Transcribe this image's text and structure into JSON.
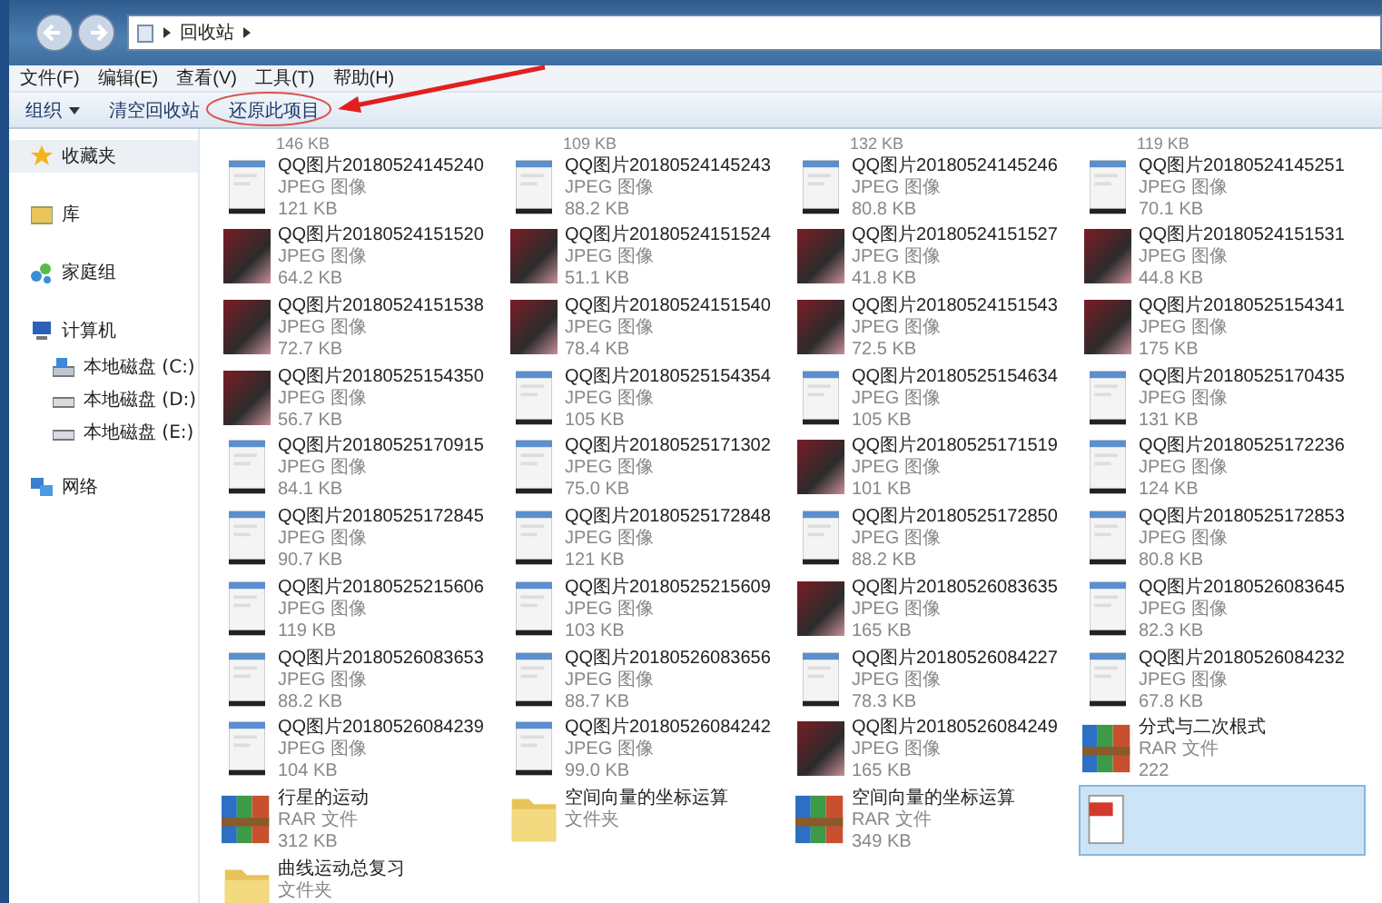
{
  "address": {
    "crumbs": [
      "回收站"
    ]
  },
  "menu": [
    "文件(F)",
    "编辑(E)",
    "查看(V)",
    "工具(T)",
    "帮助(H)"
  ],
  "toolbar": [
    {
      "label": "组织",
      "dropdown": true
    },
    {
      "label": "清空回收站",
      "dropdown": false
    },
    {
      "label": "还原此项目",
      "dropdown": false
    }
  ],
  "sidebar": [
    {
      "label": "收藏夹",
      "selected": true
    },
    {
      "label": "库",
      "selected": false
    },
    {
      "label": "家庭组",
      "selected": false
    },
    {
      "label": "计算机",
      "selected": false,
      "children": [
        {
          "label": "本地磁盘 (C:)",
          "selected": false
        },
        {
          "label": "本地磁盘 (D:)",
          "selected": false
        },
        {
          "label": "本地磁盘 (E:)",
          "selected": false
        }
      ]
    },
    {
      "label": "网络",
      "selected": false
    }
  ],
  "partial_sizes": [
    "146 KB",
    "109 KB",
    "132 KB",
    "119 KB"
  ],
  "files": [
    {
      "name": "QQ图片20180524145240",
      "type": "JPEG 图像",
      "size": "121 KB",
      "kind": "phone",
      "selected": false
    },
    {
      "name": "QQ图片20180524145243",
      "type": "JPEG 图像",
      "size": "88.2 KB",
      "kind": "phone",
      "selected": false
    },
    {
      "name": "QQ图片20180524145246",
      "type": "JPEG 图像",
      "size": "80.8 KB",
      "kind": "phone",
      "selected": false
    },
    {
      "name": "QQ图片20180524145251",
      "type": "JPEG 图像",
      "size": "70.1 KB",
      "kind": "phone",
      "selected": false
    },
    {
      "name": "QQ图片20180524151520",
      "type": "JPEG 图像",
      "size": "64.2 KB",
      "kind": "photo",
      "selected": false
    },
    {
      "name": "QQ图片20180524151524",
      "type": "JPEG 图像",
      "size": "51.1 KB",
      "kind": "photo",
      "selected": false
    },
    {
      "name": "QQ图片20180524151527",
      "type": "JPEG 图像",
      "size": "41.8 KB",
      "kind": "photo",
      "selected": false
    },
    {
      "name": "QQ图片20180524151531",
      "type": "JPEG 图像",
      "size": "44.8 KB",
      "kind": "photo",
      "selected": false
    },
    {
      "name": "QQ图片20180524151538",
      "type": "JPEG 图像",
      "size": "72.7 KB",
      "kind": "photo",
      "selected": false
    },
    {
      "name": "QQ图片20180524151540",
      "type": "JPEG 图像",
      "size": "78.4 KB",
      "kind": "photo",
      "selected": false
    },
    {
      "name": "QQ图片20180524151543",
      "type": "JPEG 图像",
      "size": "72.5 KB",
      "kind": "photo",
      "selected": false
    },
    {
      "name": "QQ图片20180525154341",
      "type": "JPEG 图像",
      "size": "175 KB",
      "kind": "photo",
      "selected": false
    },
    {
      "name": "QQ图片20180525154350",
      "type": "JPEG 图像",
      "size": "56.7 KB",
      "kind": "photo",
      "selected": false
    },
    {
      "name": "QQ图片20180525154354",
      "type": "JPEG 图像",
      "size": "105 KB",
      "kind": "phone",
      "selected": false
    },
    {
      "name": "QQ图片20180525154634",
      "type": "JPEG 图像",
      "size": "105 KB",
      "kind": "phone",
      "selected": false
    },
    {
      "name": "QQ图片20180525170435",
      "type": "JPEG 图像",
      "size": "131 KB",
      "kind": "phone",
      "selected": false
    },
    {
      "name": "QQ图片20180525170915",
      "type": "JPEG 图像",
      "size": "84.1 KB",
      "kind": "phone",
      "selected": false
    },
    {
      "name": "QQ图片20180525171302",
      "type": "JPEG 图像",
      "size": "75.0 KB",
      "kind": "phone",
      "selected": false
    },
    {
      "name": "QQ图片20180525171519",
      "type": "JPEG 图像",
      "size": "101 KB",
      "kind": "photo",
      "selected": false
    },
    {
      "name": "QQ图片20180525172236",
      "type": "JPEG 图像",
      "size": "124 KB",
      "kind": "phone",
      "selected": false
    },
    {
      "name": "QQ图片20180525172845",
      "type": "JPEG 图像",
      "size": "90.7 KB",
      "kind": "phone",
      "selected": false
    },
    {
      "name": "QQ图片20180525172848",
      "type": "JPEG 图像",
      "size": "121 KB",
      "kind": "phone",
      "selected": false
    },
    {
      "name": "QQ图片20180525172850",
      "type": "JPEG 图像",
      "size": "88.2 KB",
      "kind": "phone",
      "selected": false
    },
    {
      "name": "QQ图片20180525172853",
      "type": "JPEG 图像",
      "size": "80.8 KB",
      "kind": "phone",
      "selected": false
    },
    {
      "name": "QQ图片20180525215606",
      "type": "JPEG 图像",
      "size": "119 KB",
      "kind": "phone",
      "selected": false
    },
    {
      "name": "QQ图片20180525215609",
      "type": "JPEG 图像",
      "size": "103 KB",
      "kind": "phone",
      "selected": false
    },
    {
      "name": "QQ图片20180526083635",
      "type": "JPEG 图像",
      "size": "165 KB",
      "kind": "photo",
      "selected": false
    },
    {
      "name": "QQ图片20180526083645",
      "type": "JPEG 图像",
      "size": "82.3 KB",
      "kind": "phone",
      "selected": false
    },
    {
      "name": "QQ图片20180526083653",
      "type": "JPEG 图像",
      "size": "88.2 KB",
      "kind": "phone",
      "selected": false
    },
    {
      "name": "QQ图片20180526083656",
      "type": "JPEG 图像",
      "size": "88.7 KB",
      "kind": "phone",
      "selected": false
    },
    {
      "name": "QQ图片20180526084227",
      "type": "JPEG 图像",
      "size": "78.3 KB",
      "kind": "phone",
      "selected": false
    },
    {
      "name": "QQ图片20180526084232",
      "type": "JPEG 图像",
      "size": "67.8 KB",
      "kind": "phone",
      "selected": false
    },
    {
      "name": "QQ图片20180526084239",
      "type": "JPEG 图像",
      "size": "104 KB",
      "kind": "phone",
      "selected": false
    },
    {
      "name": "QQ图片20180526084242",
      "type": "JPEG 图像",
      "size": "99.0 KB",
      "kind": "phone",
      "selected": false
    },
    {
      "name": "QQ图片20180526084249",
      "type": "JPEG 图像",
      "size": "165 KB",
      "kind": "photo",
      "selected": false
    },
    {
      "name": "分式与二次根式",
      "type": "RAR 文件",
      "size": "222",
      "kind": "rar",
      "selected": false
    },
    {
      "name": "行星的运动",
      "type": "RAR 文件",
      "size": "312 KB",
      "kind": "rar",
      "selected": false
    },
    {
      "name": "空间向量的坐标运算",
      "type": "文件夹",
      "kind": "folder",
      "selected": false
    },
    {
      "name": "空间向量的坐标运算",
      "type": "RAR 文件",
      "size": "349 KB",
      "kind": "rar",
      "selected": false
    },
    {
      "kind": "doc",
      "selected": true
    },
    {
      "name": "曲线运动总复习",
      "type": "文件夹",
      "kind": "folder",
      "selected": false
    }
  ]
}
